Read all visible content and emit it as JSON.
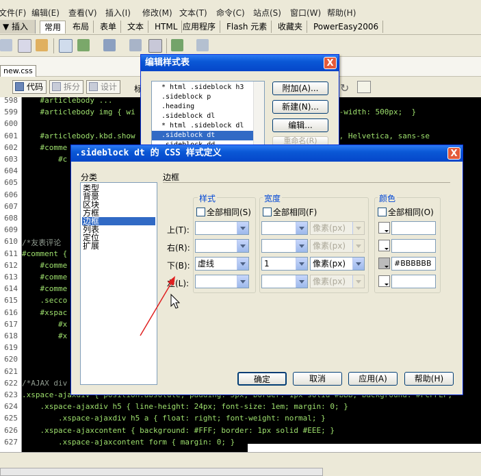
{
  "menubar": {
    "items": [
      "文件(F)",
      "编辑(E)",
      "查看(V)",
      "插入(I)",
      "修改(M)",
      "文本(T)",
      "命令(C)",
      "站点(S)",
      "窗口(W)",
      "帮助(H)"
    ]
  },
  "insertbar": {
    "label": "▼ 插入",
    "tabs": [
      "常用",
      "布局",
      "表单",
      "文本",
      "HTML",
      "应用程序",
      "Flash 元素",
      "收藏夹",
      "PowerEasy2006"
    ],
    "active_tab": "常用"
  },
  "document": {
    "tab_label": "new.css",
    "toolbar": {
      "code": "代码",
      "split": "拆分",
      "design": "设计",
      "title_partial": "标"
    }
  },
  "code": {
    "lines": [
      {
        "n": "598",
        "text": "    #articlebody ...                                                         "
      },
      {
        "n": "599",
        "text": "    #articlebody img { wi                                    rue), max-width: 500px;  }"
      },
      {
        "n": "600",
        "text": ""
      },
      {
        "n": "601",
        "text": "    #articlebody.kbd.show                                    lem Arial, Helvetica, sans-se"
      },
      {
        "n": "602",
        "text": "    #comme                                                                          5px;"
      },
      {
        "n": "603",
        "text": "        #c                                                                          bord"
      },
      {
        "n": "604",
        "text": "                                                                                    0: t"
      },
      {
        "n": "605",
        "text": "                                                                                     tex"
      },
      {
        "n": "606",
        "text": ""
      },
      {
        "n": "607",
        "text": "                                                                                    iv {"
      },
      {
        "n": "608",
        "text": "                                                                                    div"
      },
      {
        "n": "609",
        "text": ""
      },
      {
        "n": "610",
        "text": "/*友表评论"
      },
      {
        "n": "611",
        "text": "#comment {"
      },
      {
        "n": "612",
        "text": "    #comme"
      },
      {
        "n": "613",
        "text": "    #comme"
      },
      {
        "n": "614",
        "text": "    #comme"
      },
      {
        "n": "615",
        "text": "    .secco"
      },
      {
        "n": "616",
        "text": "    #xspac"
      },
      {
        "n": "617",
        "text": "        #x"
      },
      {
        "n": "618",
        "text": "        #x                                                                          20p"
      },
      {
        "n": "619",
        "text": ""
      },
      {
        "n": "620",
        "text": "                                                                                    #xsp"
      },
      {
        "n": "621",
        "text": ""
      },
      {
        "n": "622",
        "text": "/*AJAX div"
      },
      {
        "n": "623",
        "text": ".xspace-ajaxdiv { position:absolute; padding: 5px; border: 1px solid #BBB; background: #FCFFEF;"
      },
      {
        "n": "624",
        "text": "    .xspace-ajaxdiv h5 { line-height: 24px; font-size: 1em; margin: 0; }"
      },
      {
        "n": "625",
        "text": "        .xspace-ajaxdiv h5 a { float: right; font-weight: normal; }"
      },
      {
        "n": "626",
        "text": "    .xspace-ajaxcontent { background: #FFF; border: 1px solid #EEE; }"
      },
      {
        "n": "627",
        "text": "        .xspace-ajaxcontent form { margin: 0; }"
      }
    ]
  },
  "edit_style_dialog": {
    "title": "编辑样式表",
    "close": "X",
    "items": [
      "* html .sideblock h3",
      ".sideblock p",
      ".heading",
      ".sideblock dl",
      "* html .sideblock dl",
      ".sideblock dt",
      ".sideblock dd"
    ],
    "selected_index": 5,
    "buttons": {
      "attach": "附加(A)...",
      "new": "新建(N)...",
      "edit": "编辑...",
      "rename": "重命名(R)"
    }
  },
  "css_def_dialog": {
    "title": ".sideblock dt 的 CSS 样式定义",
    "close": "X",
    "category_label": "分类",
    "categories": [
      "类型",
      "背景",
      "区块",
      "方框",
      "边框",
      "列表",
      "定位",
      "扩展"
    ],
    "selected_category": "边框",
    "section_title": "边框",
    "groups": {
      "style": {
        "legend": "样式",
        "same_all": "全部相同(S)"
      },
      "width": {
        "legend": "宽度",
        "same_all": "全部相同(F)"
      },
      "color": {
        "legend": "颜色",
        "same_all": "全部相同(O)"
      }
    },
    "sides": [
      "上(T):",
      "右(R):",
      "下(B):",
      "左(L):"
    ],
    "rows": [
      {
        "style": "",
        "width": "",
        "unit": "像素(px)",
        "color": ""
      },
      {
        "style": "",
        "width": "",
        "unit": "像素(px)",
        "color": ""
      },
      {
        "style": "虚线",
        "width": "1",
        "unit": "像素(px)",
        "color": "#BBBBBB"
      },
      {
        "style": "",
        "width": "",
        "unit": "像素(px)",
        "color": ""
      }
    ],
    "buttons": {
      "ok": "确定",
      "cancel": "取消",
      "apply": "应用(A)",
      "help": "帮助(H)"
    }
  },
  "colors": {
    "code_bg": "#000000",
    "code_fg": "#9ee06d",
    "title_bar": "#0a58d6",
    "selection": "#316ac5",
    "annotation_arrow": "#e02020"
  }
}
